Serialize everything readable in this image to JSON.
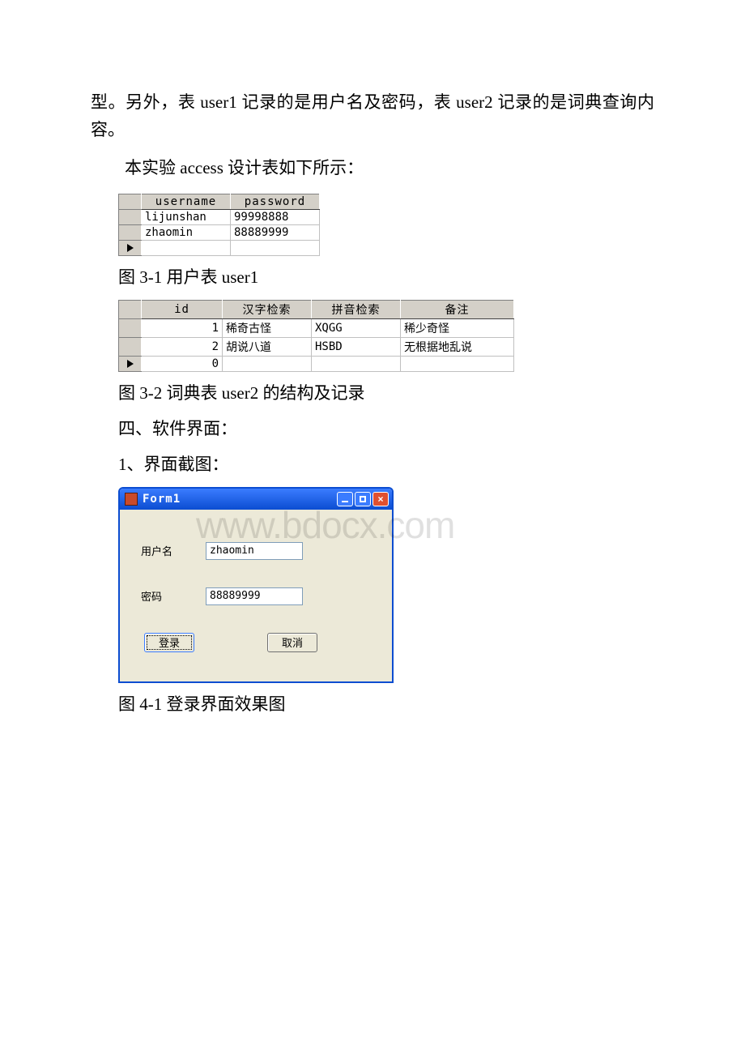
{
  "text": {
    "intro": "型。另外，表 user1 记录的是用户名及密码，表 user2 记录的是词典查询内容。",
    "access_line": "本实验 access 设计表如下所示：",
    "cap_3_1": "图 3-1 用户表 user1",
    "cap_3_2": "图 3-2 词典表 user2 的结构及记录",
    "heading4": "四、软件界面：",
    "sub1": "1、界面截图：",
    "cap_4_1": "图 4-1 登录界面效果图"
  },
  "user1": {
    "headers": {
      "c1": "username",
      "c2": "password"
    },
    "rows": [
      {
        "username": "lijunshan",
        "password": "99998888"
      },
      {
        "username": "zhaomin",
        "password": "88889999"
      }
    ]
  },
  "user2": {
    "headers": {
      "c1": "id",
      "c2": "汉字检索",
      "c3": "拼音检索",
      "c4": "备注"
    },
    "rows": [
      {
        "id": "1",
        "hanzi": "稀奇古怪",
        "pinyin": "XQGG",
        "note": "稀少奇怪"
      },
      {
        "id": "2",
        "hanzi": "胡说八道",
        "pinyin": "HSBD",
        "note": "无根据地乱说"
      }
    ],
    "newrow_id": "0"
  },
  "form1": {
    "title": "Form1",
    "username_label": "用户名",
    "password_label": "密码",
    "username_value": "zhaomin",
    "password_value": "88889999",
    "login_label": "登录",
    "cancel_label": "取消"
  },
  "watermark": "www.bdocx.com"
}
